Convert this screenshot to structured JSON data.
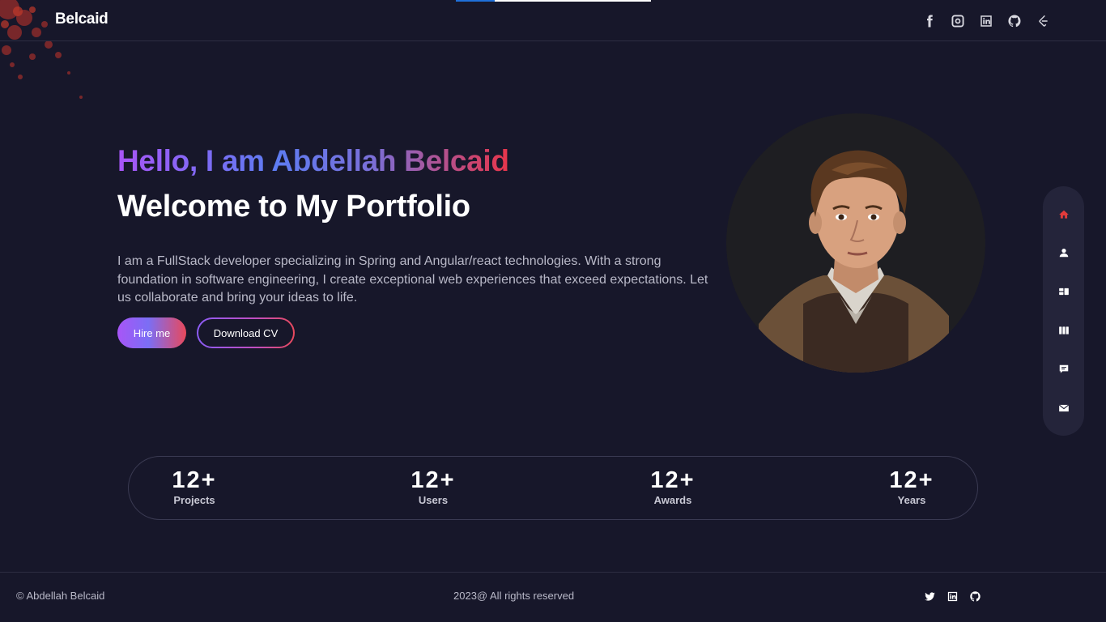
{
  "header": {
    "brand": "Belcaid",
    "scroll_progress": 0.2,
    "social_icons": [
      "facebook-icon",
      "instagram-icon",
      "linkedin-icon",
      "github-icon",
      "leetcode-icon"
    ]
  },
  "hero": {
    "greeting": "Hello, I am Abdellah Belcaid",
    "welcome": "Welcome to My Portfolio",
    "description": "I am a FullStack developer specializing in Spring and Angular/react technologies. With a strong foundation in software engineering, I create exceptional web experiences that exceed expectations. Let us collaborate and bring your ideas to life.",
    "hire_label": "Hire me",
    "cv_label": "Download CV"
  },
  "sidenav": {
    "items": [
      "home-icon",
      "user-icon",
      "services-icon",
      "portfolio-icon",
      "chat-icon",
      "mail-icon"
    ],
    "active": "home-icon",
    "active_color": "#e23b3b"
  },
  "stats": [
    {
      "value": "12+",
      "label": "Projects"
    },
    {
      "value": "12+",
      "label": "Users"
    },
    {
      "value": "12+",
      "label": "Awards"
    },
    {
      "value": "12+",
      "label": "Years"
    }
  ],
  "footer": {
    "copyright": "© Abdellah Belcaid",
    "rights": "2023@ All rights reserved",
    "social_icons": [
      "twitter-icon",
      "linkedin-icon",
      "github-icon"
    ]
  },
  "colors": {
    "background": "#17172a",
    "accent_purple": "#a855f7",
    "accent_blue": "#5d7cf2",
    "accent_red": "#e8354a"
  }
}
